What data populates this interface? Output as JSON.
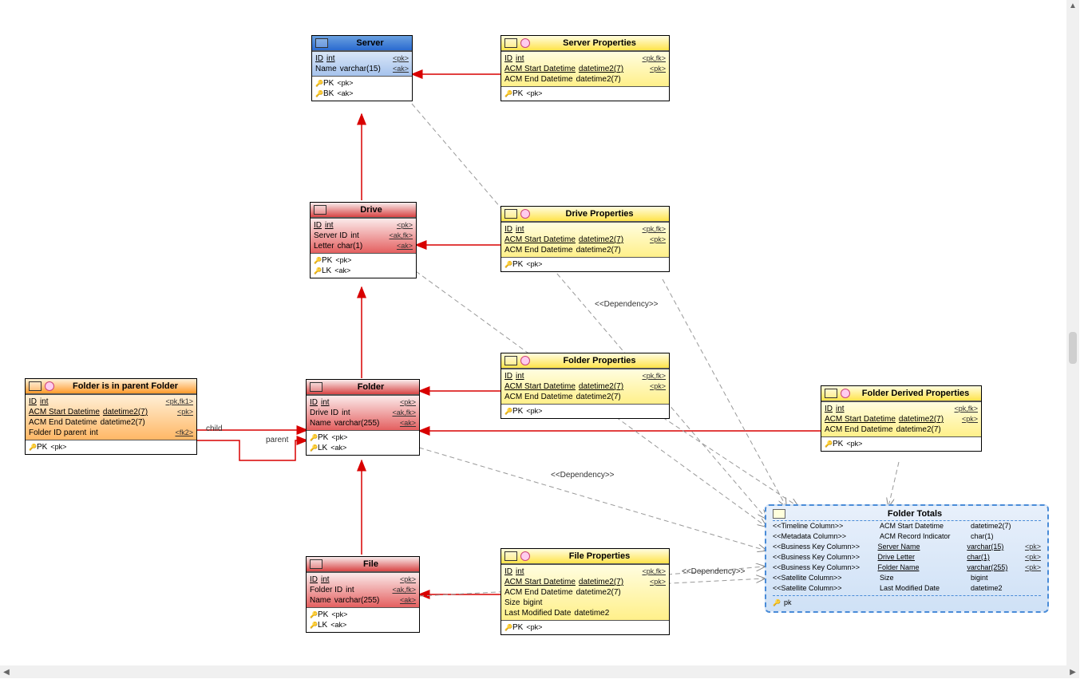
{
  "entities": {
    "server": {
      "title": "Server",
      "attrs": [
        {
          "name": "ID",
          "type": "int",
          "tag": "<pk>",
          "u": true,
          "tu": true
        },
        {
          "name": "Name",
          "type": "varchar(15)",
          "tag": "<ak>",
          "u": false,
          "tu": false
        }
      ],
      "keys": [
        {
          "k": "PK",
          "t": "<pk>"
        },
        {
          "k": "BK",
          "t": "<ak>"
        }
      ]
    },
    "serverProps": {
      "title": "Server Properties",
      "attrs": [
        {
          "name": "ID",
          "type": "int",
          "tag": "<pk,fk>",
          "u": true,
          "tu": true
        },
        {
          "name": "ACM Start Datetime",
          "type": "datetime2(7)",
          "tag": "<pk>",
          "u": true,
          "tu": true
        },
        {
          "name": "ACM End Datetime",
          "type": "datetime2(7)",
          "tag": "",
          "u": false,
          "tu": false
        }
      ],
      "keys": [
        {
          "k": "PK",
          "t": "<pk>"
        }
      ]
    },
    "drive": {
      "title": "Drive",
      "attrs": [
        {
          "name": "ID",
          "type": "int",
          "tag": "<pk>",
          "u": true,
          "tu": true
        },
        {
          "name": "Server ID",
          "type": "int",
          "tag": "<ak,fk>",
          "u": false,
          "tu": false
        },
        {
          "name": "Letter",
          "type": "char(1)",
          "tag": "<ak>",
          "u": false,
          "tu": false
        }
      ],
      "keys": [
        {
          "k": "PK",
          "t": "<pk>"
        },
        {
          "k": "LK",
          "t": "<ak>"
        }
      ]
    },
    "driveProps": {
      "title": "Drive Properties",
      "attrs": [
        {
          "name": "ID",
          "type": "int",
          "tag": "<pk,fk>",
          "u": true,
          "tu": true
        },
        {
          "name": "ACM Start Datetime",
          "type": "datetime2(7)",
          "tag": "<pk>",
          "u": true,
          "tu": true
        },
        {
          "name": "ACM End Datetime",
          "type": "datetime2(7)",
          "tag": "",
          "u": false,
          "tu": false
        }
      ],
      "keys": [
        {
          "k": "PK",
          "t": "<pk>"
        }
      ]
    },
    "folder": {
      "title": "Folder",
      "attrs": [
        {
          "name": "ID",
          "type": "int",
          "tag": "<pk>",
          "u": true,
          "tu": true
        },
        {
          "name": "Drive ID",
          "type": "int",
          "tag": "<ak,fk>",
          "u": false,
          "tu": false
        },
        {
          "name": "Name",
          "type": "varchar(255)",
          "tag": "<ak>",
          "u": false,
          "tu": false
        }
      ],
      "keys": [
        {
          "k": "PK",
          "t": "<pk>"
        },
        {
          "k": "LK",
          "t": "<ak>"
        }
      ]
    },
    "folderProps": {
      "title": "Folder Properties",
      "attrs": [
        {
          "name": "ID",
          "type": "int",
          "tag": "<pk,fk>",
          "u": true,
          "tu": true
        },
        {
          "name": "ACM Start Datetime",
          "type": "datetime2(7)",
          "tag": "<pk>",
          "u": true,
          "tu": true
        },
        {
          "name": "ACM End Datetime",
          "type": "datetime2(7)",
          "tag": "",
          "u": false,
          "tu": false
        }
      ],
      "keys": [
        {
          "k": "PK",
          "t": "<pk>"
        }
      ]
    },
    "folderInParent": {
      "title": "Folder is in parent Folder",
      "attrs": [
        {
          "name": "ID",
          "type": "int",
          "tag": "<pk,fk1>",
          "u": true,
          "tu": true
        },
        {
          "name": "ACM Start Datetime",
          "type": "datetime2(7)",
          "tag": "<pk>",
          "u": true,
          "tu": true
        },
        {
          "name": "ACM End Datetime",
          "type": "datetime2(7)",
          "tag": "",
          "u": false,
          "tu": false
        },
        {
          "name": "Folder ID parent",
          "type": "int",
          "tag": "<fk2>",
          "u": false,
          "tu": false
        }
      ],
      "keys": [
        {
          "k": "PK",
          "t": "<pk>"
        }
      ]
    },
    "folderDerivedProps": {
      "title": "Folder Derived Properties",
      "attrs": [
        {
          "name": "ID",
          "type": "int",
          "tag": "<pk,fk>",
          "u": true,
          "tu": true
        },
        {
          "name": "ACM Start Datetime",
          "type": "datetime2(7)",
          "tag": "<pk>",
          "u": true,
          "tu": true
        },
        {
          "name": "ACM End Datetime",
          "type": "datetime2(7)",
          "tag": "",
          "u": false,
          "tu": false
        }
      ],
      "keys": [
        {
          "k": "PK",
          "t": "<pk>"
        }
      ]
    },
    "file": {
      "title": "File",
      "attrs": [
        {
          "name": "ID",
          "type": "int",
          "tag": "<pk>",
          "u": true,
          "tu": true
        },
        {
          "name": "Folder ID",
          "type": "int",
          "tag": "<ak,fk>",
          "u": false,
          "tu": false
        },
        {
          "name": "Name",
          "type": "varchar(255)",
          "tag": "<ak>",
          "u": false,
          "tu": false
        }
      ],
      "keys": [
        {
          "k": "PK",
          "t": "<pk>"
        },
        {
          "k": "LK",
          "t": "<ak>"
        }
      ]
    },
    "fileProps": {
      "title": "File Properties",
      "attrs": [
        {
          "name": "ID",
          "type": "int",
          "tag": "<pk,fk>",
          "u": true,
          "tu": true
        },
        {
          "name": "ACM Start Datetime",
          "type": "datetime2(7)",
          "tag": "<pk>",
          "u": true,
          "tu": true
        },
        {
          "name": "ACM End Datetime",
          "type": "datetime2(7)",
          "tag": "",
          "u": false,
          "tu": false
        },
        {
          "name": "Size",
          "type": "bigint",
          "tag": "",
          "u": false,
          "tu": false
        },
        {
          "name": "Last Modified Date",
          "type": "datetime2",
          "tag": "",
          "u": false,
          "tu": false
        }
      ],
      "keys": [
        {
          "k": "PK",
          "t": "<pk>"
        }
      ]
    }
  },
  "folderTotals": {
    "title": "Folder Totals",
    "rows": [
      {
        "stereo": "<<Timeline Column>>",
        "name": "ACM Start Datetime",
        "type": "datetime2(7)",
        "tag": "",
        "u": false
      },
      {
        "stereo": "<<Metadata Column>>",
        "name": "ACM Record Indicator",
        "type": "char(1)",
        "tag": "",
        "u": false
      },
      {
        "stereo": "<<Business Key Column>>",
        "name": "Server Name",
        "type": "varchar(15)",
        "tag": "<pk>",
        "u": true
      },
      {
        "stereo": "<<Business Key Column>>",
        "name": "Drive Letter",
        "type": "char(1)",
        "tag": "<pk>",
        "u": true
      },
      {
        "stereo": "<<Business Key Column>>",
        "name": "Folder Name",
        "type": "varchar(255)",
        "tag": "<pk>",
        "u": true
      },
      {
        "stereo": "<<Satellite Column>>",
        "name": "Size",
        "type": "bigint",
        "tag": "",
        "u": false
      },
      {
        "stereo": "<<Satellite Column>>",
        "name": "Last Modified Date",
        "type": "datetime2",
        "tag": "",
        "u": false
      }
    ],
    "keys": [
      {
        "k": "pk",
        "t": "<pk>"
      }
    ]
  },
  "labels": {
    "dep1": "<<Dependency>>",
    "dep2": "<<Dependency>>",
    "dep3": "<<Dependency>>",
    "child": "child",
    "parent": "parent"
  }
}
